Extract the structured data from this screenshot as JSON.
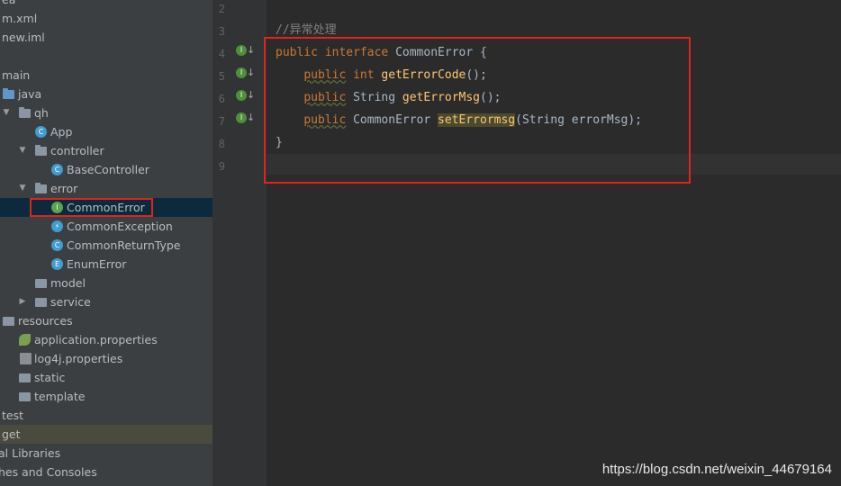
{
  "tree": {
    "items": [
      {
        "label": "ea",
        "icon": "folder-icon"
      },
      {
        "label": "m.xml",
        "icon": "maven-file-icon"
      },
      {
        "label": "new.iml",
        "icon": "iml-file-icon"
      },
      {
        "label": "",
        "icon": "folder-icon"
      },
      {
        "label": "main",
        "icon": "folder-icon"
      },
      {
        "label": "java",
        "icon": "source-folder-icon"
      },
      {
        "label": "qh",
        "icon": "package-icon"
      },
      {
        "label": "App",
        "icon": "class-icon"
      },
      {
        "label": "controller",
        "icon": "package-icon"
      },
      {
        "label": "BaseController",
        "icon": "class-icon"
      },
      {
        "label": "error",
        "icon": "package-icon"
      },
      {
        "label": "CommonError",
        "icon": "interface-icon"
      },
      {
        "label": "CommonException",
        "icon": "exception-class-icon"
      },
      {
        "label": "CommonReturnType",
        "icon": "class-icon"
      },
      {
        "label": "EnumError",
        "icon": "enum-icon"
      },
      {
        "label": "model",
        "icon": "package-icon"
      },
      {
        "label": "service",
        "icon": "package-icon"
      },
      {
        "label": "resources",
        "icon": "resources-folder-icon"
      },
      {
        "label": "application.properties",
        "icon": "spring-leaf-icon"
      },
      {
        "label": "log4j.properties",
        "icon": "properties-file-icon"
      },
      {
        "label": "static",
        "icon": "folder-icon"
      },
      {
        "label": "template",
        "icon": "folder-icon"
      },
      {
        "label": "test",
        "icon": "folder-icon"
      },
      {
        "label": "get",
        "icon": "folder-icon"
      },
      {
        "label": "al Libraries",
        "icon": "library-icon"
      },
      {
        "label": "hes and Consoles",
        "icon": "console-icon"
      }
    ]
  },
  "editor": {
    "line_numbers": [
      "2",
      "3",
      "4",
      "5",
      "6",
      "7",
      "8",
      "9"
    ],
    "comment": "//异常处理",
    "line4": {
      "kw1": "public",
      "kw2": "interface",
      "name": "CommonError",
      "brace": "{"
    },
    "line5": {
      "kw": "public",
      "type": "int",
      "fn": "getErrorCode",
      "rest": "();"
    },
    "line6": {
      "kw": "public",
      "type": "String",
      "fn": "getErrorMsg",
      "rest": "();"
    },
    "line7": {
      "kw": "public",
      "type": "CommonError",
      "fn": "setErrormsg",
      "rest": "(String errorMsg);"
    },
    "line8": "}",
    "impl_marker": "I"
  },
  "watermark": "https://blog.csdn.net/weixin_44679164"
}
